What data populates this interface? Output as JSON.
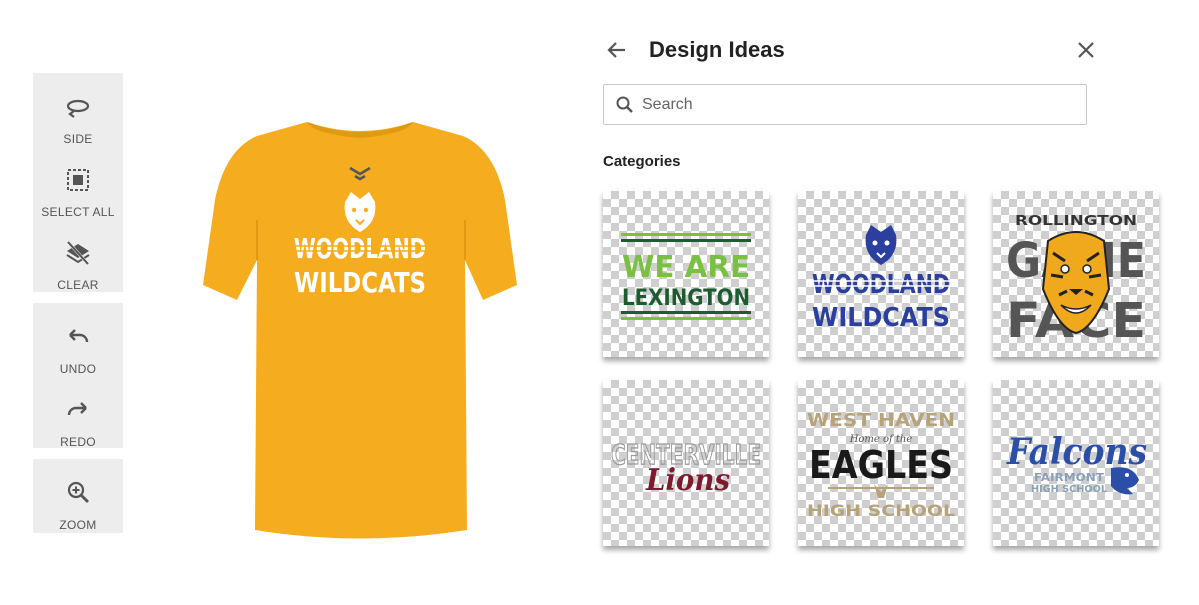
{
  "toolbar": {
    "side_label": "SIDE",
    "select_all_label": "SELECT ALL",
    "clear_label": "CLEAR",
    "undo_label": "UNDO",
    "redo_label": "REDO",
    "zoom_label": "ZOOM"
  },
  "preview": {
    "shirt_color": "#f5ac1e",
    "design_line1": "WOODLAND",
    "design_line2": "WILDCATS"
  },
  "panel": {
    "title": "Design Ideas",
    "search_placeholder": "Search",
    "categories_label": "Categories",
    "cards": [
      {
        "line1": "WE ARE",
        "line2": "LEXINGTON"
      },
      {
        "line1": "WOODLAND",
        "line2": "WILDCATS"
      },
      {
        "line1": "ROLLINGTON",
        "line2": "GAME",
        "line3": "FACE"
      },
      {
        "line1": "CENTERVILLE",
        "line2": "Lions"
      },
      {
        "line1": "WEST HAVEN",
        "line2": "Home of the",
        "line3": "EAGLES",
        "line4": "HIGH SCHOOL"
      },
      {
        "line1": "Falcons",
        "line2": "FAIRMONT",
        "line3": "HIGH SCHOOL"
      }
    ]
  },
  "colors": {
    "toolbar_bg": "#ededed",
    "lexington_green": "#7ac143",
    "lexington_dark": "#1e5b2f",
    "wildcats_blue": "#2a3f9e",
    "rollington_gray": "#555555",
    "lions_maroon": "#7e1a2e",
    "eagles_gold": "#b7a27a",
    "falcons_blue": "#2b4fa8"
  }
}
